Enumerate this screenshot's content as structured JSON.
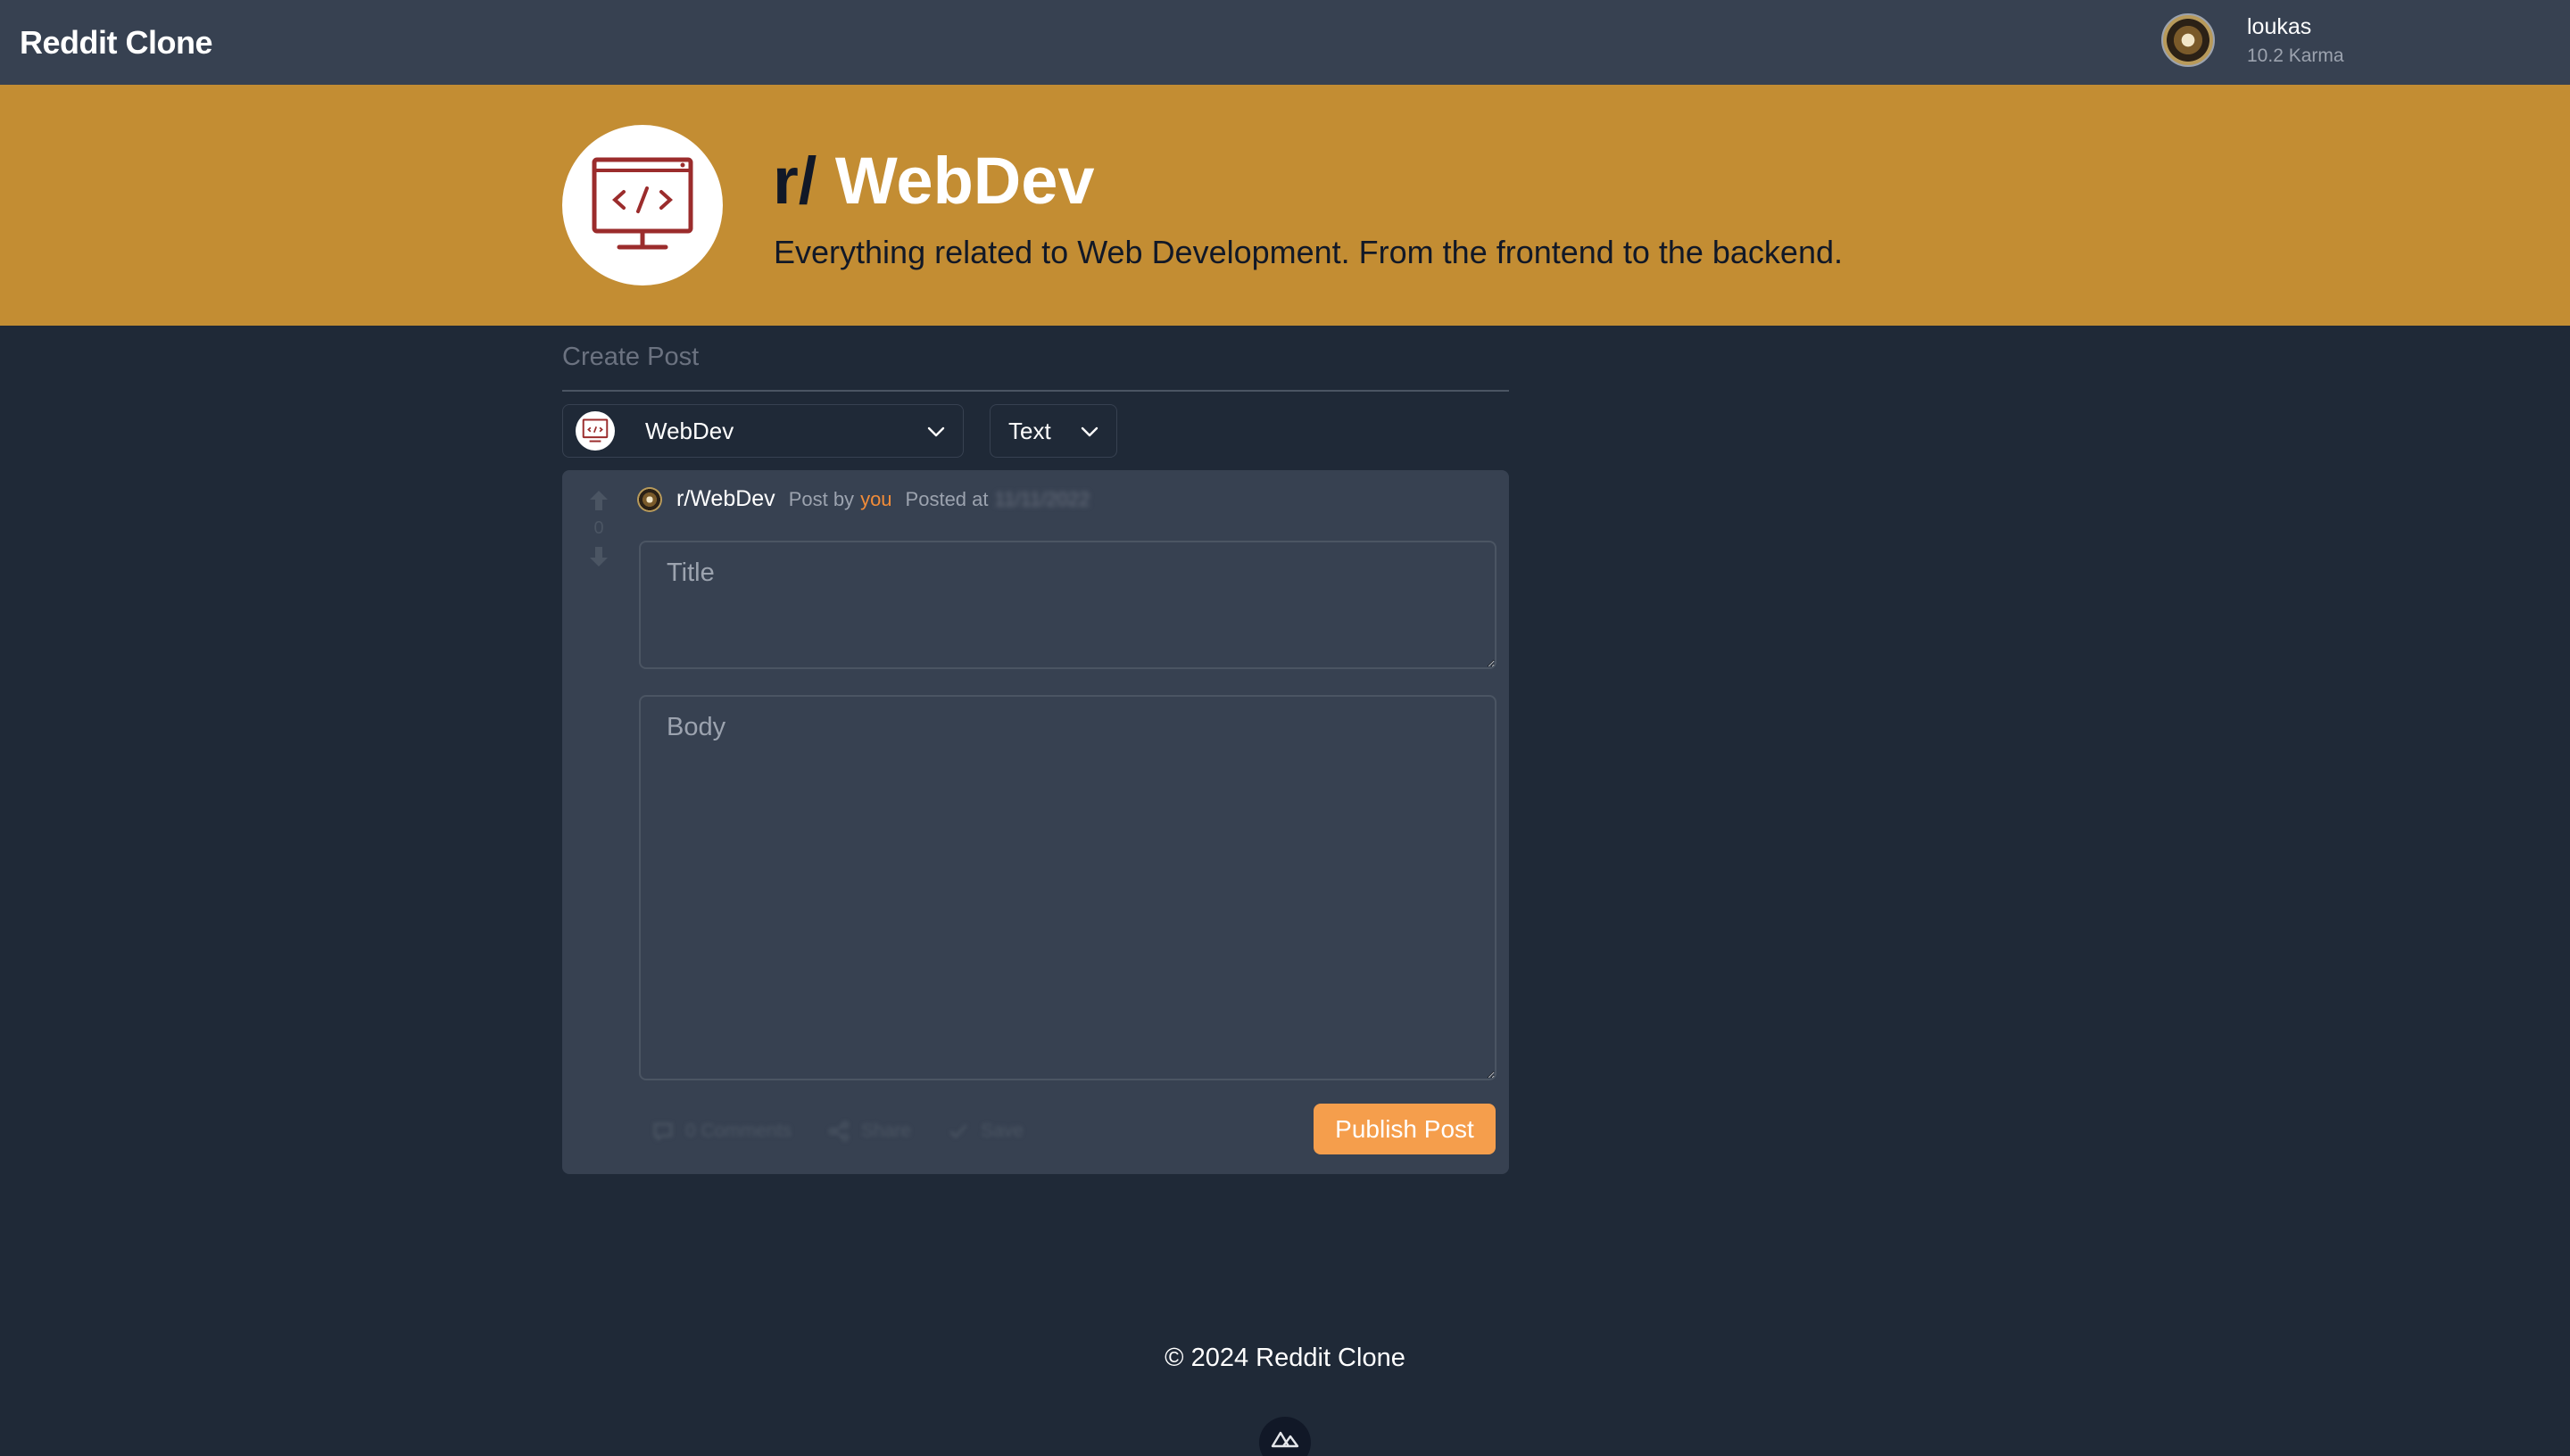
{
  "navbar": {
    "brand": "Reddit Clone",
    "user": {
      "name": "loukas",
      "karma": "10.2 Karma"
    }
  },
  "banner": {
    "prefix": "r/",
    "name": "WebDev",
    "description": "Everything related to Web Development. From the frontend to the backend.",
    "color": "#c38d33",
    "icon": "code-monitor-icon"
  },
  "create": {
    "title": "Create Post",
    "community_select": "WebDev",
    "type_select": "Text"
  },
  "post": {
    "vote_count": "0",
    "subreddit": "r/WebDev",
    "post_by": "Post by",
    "author": "you",
    "posted_at": "Posted at",
    "date": "11/11/2022",
    "title_placeholder": "Title",
    "body_placeholder": "Body",
    "actions": {
      "comments": "0 Comments",
      "share": "Share",
      "save": "Save"
    },
    "publish": "Publish Post"
  },
  "footer": {
    "text": "© 2024 Reddit Clone"
  },
  "colors": {
    "accent": "#f59e4c",
    "background": "#1f2937",
    "surface": "#374151"
  }
}
